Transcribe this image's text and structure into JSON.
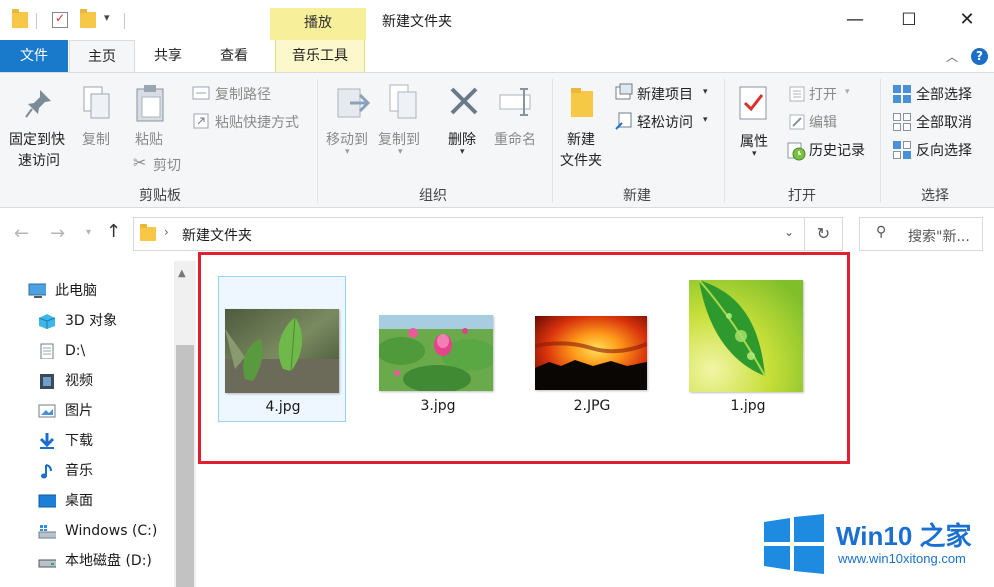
{
  "titlebar": {
    "context_tab": "播放",
    "window_title": "新建文件夹",
    "minimize": "—",
    "maximize": "☐",
    "close": "✕"
  },
  "tabs": {
    "file": "文件",
    "home": "主页",
    "share": "共享",
    "view": "查看",
    "music_tools": "音乐工具"
  },
  "ribbon": {
    "clipboard": {
      "pin_line1": "固定到快",
      "pin_line2": "速访问",
      "copy": "复制",
      "paste": "粘贴",
      "copy_path": "复制路径",
      "paste_shortcut": "粘贴快捷方式",
      "cut": "剪切",
      "label": "剪贴板"
    },
    "organize": {
      "move_to": "移动到",
      "copy_to": "复制到",
      "delete": "删除",
      "rename": "重命名",
      "label": "组织"
    },
    "new": {
      "new_folder_line1": "新建",
      "new_folder_line2": "文件夹",
      "new_item": "新建项目",
      "easy_access": "轻松访问",
      "label": "新建"
    },
    "open": {
      "properties": "属性",
      "open": "打开",
      "edit": "编辑",
      "history": "历史记录",
      "label": "打开"
    },
    "select": {
      "select_all": "全部选择",
      "select_none": "全部取消",
      "invert": "反向选择",
      "label": "选择"
    }
  },
  "address": {
    "path": "新建文件夹",
    "search_placeholder": "搜索\"新..."
  },
  "navpane": {
    "items": [
      {
        "label": "此电脑",
        "icon": "computer-icon"
      },
      {
        "label": "3D 对象",
        "icon": "3d-objects-icon"
      },
      {
        "label": "D:\\",
        "icon": "document-icon"
      },
      {
        "label": "视频",
        "icon": "video-icon"
      },
      {
        "label": "图片",
        "icon": "pictures-icon"
      },
      {
        "label": "下载",
        "icon": "download-icon"
      },
      {
        "label": "音乐",
        "icon": "music-icon"
      },
      {
        "label": "桌面",
        "icon": "desktop-icon"
      },
      {
        "label": "Windows (C:)",
        "icon": "windows-drive-icon"
      },
      {
        "label": "本地磁盘 (D:)",
        "icon": "local-disk-icon"
      }
    ]
  },
  "files": [
    {
      "name": "4.jpg",
      "selected": true
    },
    {
      "name": "3.jpg",
      "selected": false
    },
    {
      "name": "2.JPG",
      "selected": false
    },
    {
      "name": "1.jpg",
      "selected": false
    }
  ],
  "watermark": {
    "title": "Win10 之家",
    "url": "www.win10xitong.com"
  },
  "colors": {
    "file_tab": "#1979ca",
    "context_tab": "#f8ef9a",
    "highlight_box": "#e02030",
    "selection": "#99d1ff"
  }
}
